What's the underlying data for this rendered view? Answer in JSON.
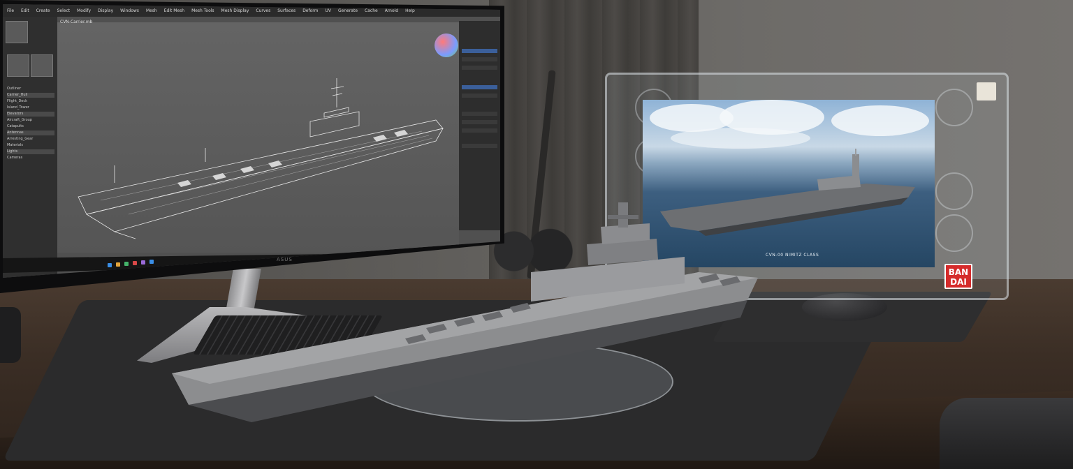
{
  "scene": {
    "description_free": true
  },
  "monitor": {
    "brand": "ASUS",
    "menu_items": [
      "File",
      "Edit",
      "Create",
      "Select",
      "Modify",
      "Display",
      "Windows",
      "Mesh",
      "Edit Mesh",
      "Mesh Tools",
      "Mesh Display",
      "Curves",
      "Surfaces",
      "Deform",
      "UV",
      "Generate",
      "Cache",
      "Arnold",
      "Help"
    ],
    "viewport_title": "CVN-Carrier.mb",
    "left_panel_rows": [
      "Outliner",
      "Carrier_Hull",
      "Flight_Deck",
      "Island_Tower",
      "Elevators",
      "Aircraft_Group",
      "Catapults",
      "Antennas",
      "Arresting_Gear",
      "Materials",
      "Lights",
      "Cameras"
    ]
  },
  "poster": {
    "caption": "CVN-00 NIMITZ CLASS"
  },
  "display_case": {
    "brand_badge": "BANDAI"
  },
  "colors": {
    "brand_red": "#d52b2b",
    "viewport_gray": "#5a5a5a",
    "ui_accent": "#3b5f9a"
  }
}
